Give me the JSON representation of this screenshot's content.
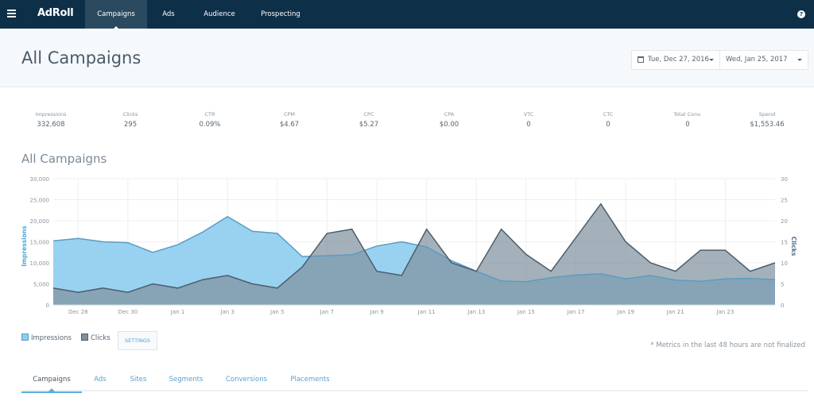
{
  "app": {
    "logo": "AdRoll"
  },
  "nav": {
    "items": [
      {
        "label": "Campaigns",
        "active": true
      },
      {
        "label": "Ads",
        "active": false
      },
      {
        "label": "Audience",
        "active": false
      },
      {
        "label": "Prospecting",
        "active": false
      }
    ],
    "help_icon": "question-circle-icon"
  },
  "header": {
    "title": "All Campaigns",
    "date_start": "Tue, Dec 27, 2016",
    "date_end": "Wed, Jan 25, 2017"
  },
  "stats": [
    {
      "label": "Impressions",
      "value": "332,608"
    },
    {
      "label": "Clicks",
      "value": "295"
    },
    {
      "label": "CTR",
      "value": "0.09%"
    },
    {
      "label": "CPM",
      "value": "$4.67"
    },
    {
      "label": "CPC",
      "value": "$5.27"
    },
    {
      "label": "CPA",
      "value": "$0.00"
    },
    {
      "label": "VTC",
      "value": "0"
    },
    {
      "label": "CTC",
      "value": "0"
    },
    {
      "label": "Total Conv.",
      "value": "0"
    },
    {
      "label": "Spend",
      "value": "$1,553.46"
    }
  ],
  "chart_title": "All Campaigns",
  "legend": {
    "impressions": "Impressions",
    "clicks": "Clicks",
    "settings_label": "SETTINGS"
  },
  "footnote": "* Metrics in the last 48 hours are not finalized",
  "tabs": [
    {
      "label": "Campaigns",
      "active": true
    },
    {
      "label": "Ads",
      "active": false
    },
    {
      "label": "Sites",
      "active": false
    },
    {
      "label": "Segments",
      "active": false
    },
    {
      "label": "Conversions",
      "active": false
    },
    {
      "label": "Placements",
      "active": false
    }
  ],
  "colors": {
    "impressions_fill": "#8ecdf0",
    "impressions_line": "#5a9cc4",
    "clicks_fill": "#7e909d",
    "clicks_line": "#4c5e6b",
    "overlap_fill": "#6f9bb5",
    "nav_bg": "#0e2f48",
    "accent": "#5aa0d0"
  },
  "chart_data": {
    "type": "area",
    "title": "All Campaigns",
    "x": [
      "Dec 27",
      "Dec 28",
      "Dec 29",
      "Dec 30",
      "Dec 31",
      "Jan 1",
      "Jan 2",
      "Jan 3",
      "Jan 4",
      "Jan 5",
      "Jan 6",
      "Jan 7",
      "Jan 8",
      "Jan 9",
      "Jan 10",
      "Jan 11",
      "Jan 12",
      "Jan 13",
      "Jan 14",
      "Jan 15",
      "Jan 16",
      "Jan 17",
      "Jan 18",
      "Jan 19",
      "Jan 20",
      "Jan 21",
      "Jan 22",
      "Jan 23",
      "Jan 24",
      "Jan 25"
    ],
    "x_tick_labels": [
      "Dec 28",
      "Dec 30",
      "Jan 1",
      "Jan 3",
      "Jan 5",
      "Jan 7",
      "Jan 9",
      "Jan 11",
      "Jan 13",
      "Jan 15",
      "Jan 17",
      "Jan 19",
      "Jan 21",
      "Jan 23"
    ],
    "series": [
      {
        "name": "Impressions",
        "axis": "left",
        "values": [
          15200,
          15800,
          15000,
          14800,
          12500,
          14300,
          17300,
          21000,
          17500,
          17000,
          11500,
          11700,
          11900,
          14000,
          15000,
          13800,
          10500,
          8000,
          5700,
          5500,
          6500,
          7100,
          7400,
          6200,
          7000,
          5900,
          5600,
          6200,
          6300,
          6000
        ]
      },
      {
        "name": "Clicks",
        "axis": "right",
        "values": [
          4,
          3,
          4,
          3,
          5,
          4,
          6,
          7,
          5,
          4,
          9,
          17,
          18,
          8,
          7,
          18,
          10,
          8,
          18,
          12,
          8,
          16,
          24,
          15,
          10,
          8,
          13,
          13,
          8,
          10
        ]
      }
    ],
    "ylabel": "Impressions",
    "ylabel_right": "Clicks",
    "ylim": [
      0,
      30000
    ],
    "ylim_right": [
      0,
      30
    ],
    "y_ticks": [
      "0",
      "5,000",
      "10,000",
      "15,000",
      "20,000",
      "25,000",
      "30,000"
    ],
    "y_ticks_right": [
      "0",
      "5",
      "10",
      "15",
      "20",
      "25",
      "30"
    ],
    "grid": true,
    "legend_position": "bottom-left"
  }
}
